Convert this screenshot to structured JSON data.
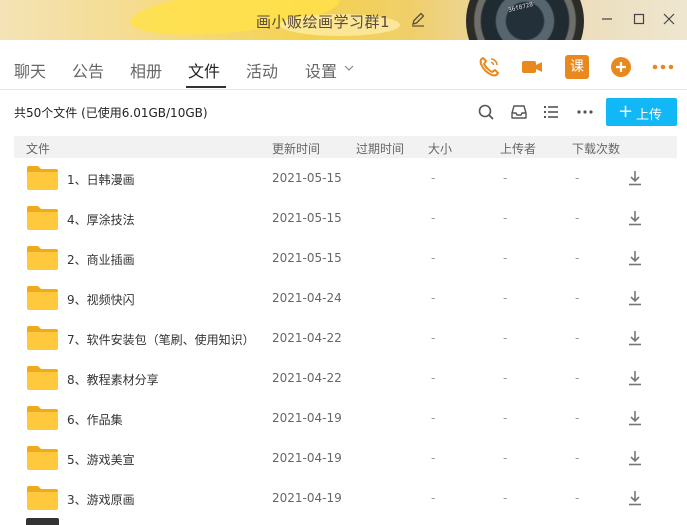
{
  "window": {
    "group_name": "画小贩绘画学习群1",
    "lens_text": "36f8728"
  },
  "tabs": [
    {
      "label": "聊天",
      "active": false
    },
    {
      "label": "公告",
      "active": false
    },
    {
      "label": "相册",
      "active": false
    },
    {
      "label": "文件",
      "active": true
    },
    {
      "label": "活动",
      "active": false
    },
    {
      "label": "设置",
      "active": false
    }
  ],
  "header_icons": [
    "phone-icon",
    "video-icon",
    "lesson-icon",
    "add-circle-icon",
    "more-icon"
  ],
  "lesson_icon_label": "课",
  "toolbar": {
    "summary": "共50个文件 (已使用6.01GB/10GB)",
    "upload_label": "上传"
  },
  "colors": {
    "accent": "#12b7f5",
    "brand_orange": "#e9891d",
    "folder": "#ffc83d"
  },
  "table": {
    "columns": [
      "文件",
      "更新时间",
      "过期时间",
      "大小",
      "上传者",
      "下载次数"
    ],
    "rows": [
      {
        "name": "1、日韩漫画",
        "date": "2021-05-15",
        "expire": "-",
        "size": "-",
        "uploader": "-",
        "downloads": "-"
      },
      {
        "name": "4、厚涂技法",
        "date": "2021-05-15",
        "expire": "-",
        "size": "-",
        "uploader": "-",
        "downloads": "-"
      },
      {
        "name": "2、商业插画",
        "date": "2021-05-15",
        "expire": "-",
        "size": "-",
        "uploader": "-",
        "downloads": "-"
      },
      {
        "name": "9、视频快闪",
        "date": "2021-04-24",
        "expire": "-",
        "size": "-",
        "uploader": "-",
        "downloads": "-"
      },
      {
        "name": "7、软件安装包（笔刷、使用知识）",
        "date": "2021-04-22",
        "expire": "-",
        "size": "-",
        "uploader": "-",
        "downloads": "-"
      },
      {
        "name": "8、教程素材分享",
        "date": "2021-04-22",
        "expire": "-",
        "size": "-",
        "uploader": "-",
        "downloads": "-"
      },
      {
        "name": "6、作品集",
        "date": "2021-04-19",
        "expire": "-",
        "size": "-",
        "uploader": "-",
        "downloads": "-"
      },
      {
        "name": "5、游戏美宣",
        "date": "2021-04-19",
        "expire": "-",
        "size": "-",
        "uploader": "-",
        "downloads": "-"
      },
      {
        "name": "3、游戏原画",
        "date": "2021-04-19",
        "expire": "-",
        "size": "-",
        "uploader": "-",
        "downloads": "-"
      }
    ]
  }
}
